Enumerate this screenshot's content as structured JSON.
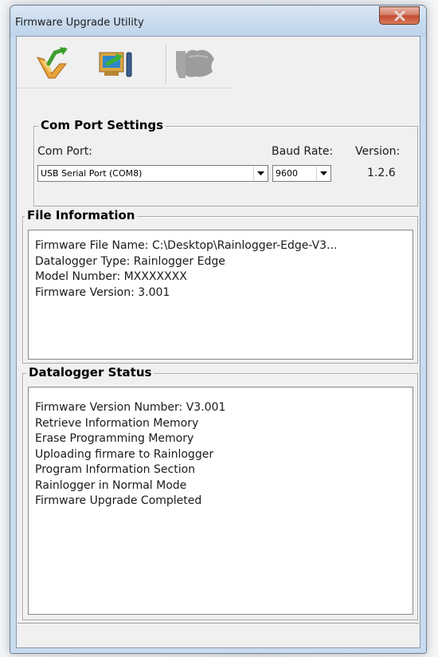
{
  "window": {
    "title": "Firmware Upgrade Utility"
  },
  "toolbar": {
    "tools": [
      {
        "name": "open-firmware-icon"
      },
      {
        "name": "upload-to-device-icon"
      },
      {
        "name": "logger-device-icon"
      }
    ]
  },
  "com_port_settings": {
    "title": "Com Port Settings",
    "com_port_label": "Com Port:",
    "com_port_value": "USB Serial Port (COM8)",
    "baud_rate_label": "Baud Rate:",
    "baud_rate_value": "9600",
    "version_label": "Version:",
    "version_value": "1.2.6"
  },
  "file_information": {
    "title": "File Information",
    "lines": [
      "Firmware File Name: C:\\Desktop\\Rainlogger-Edge-V3...",
      "Datalogger Type: Rainlogger Edge",
      "Model Number: MXXXXXXX",
      "Firmware Version: 3.001"
    ]
  },
  "datalogger_status": {
    "title": "Datalogger Status",
    "lines": [
      "Firmware Version Number: V3.001",
      "Retrieve Information Memory",
      "Erase Programming Memory",
      "Uploading firmare to Rainlogger",
      "Program Information Section",
      "Rainlogger in Normal Mode",
      "Firmware Upgrade Completed"
    ]
  },
  "colors": {
    "title_bar": "#c7daee",
    "close_button": "#c24b31",
    "client_background": "#f0f0f0"
  }
}
